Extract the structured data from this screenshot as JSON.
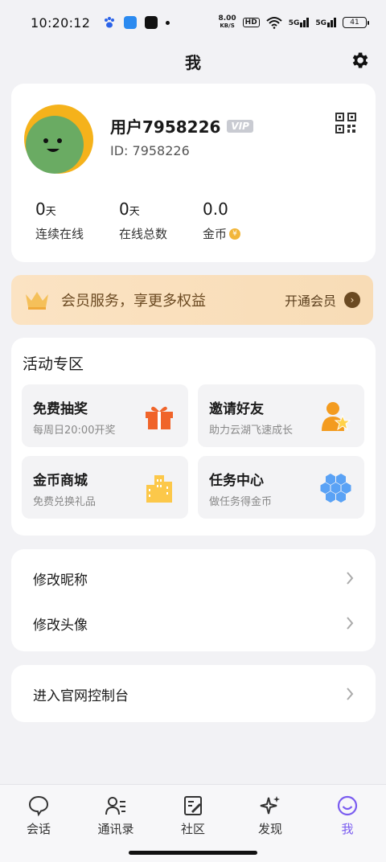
{
  "status_bar": {
    "time": "10:20:12",
    "net_speed": "8.00",
    "net_unit": "KB/S",
    "hd": "HD",
    "signal1": "5G",
    "signal2": "5G",
    "battery": "41"
  },
  "header": {
    "title": "我"
  },
  "profile": {
    "username": "用户7958226",
    "vip_badge": "VIP",
    "user_id": "ID: 7958226",
    "stats": [
      {
        "value": "0",
        "unit": "天",
        "label": "连续在线"
      },
      {
        "value": "0",
        "unit": "天",
        "label": "在线总数"
      },
      {
        "value": "0.0",
        "unit": "",
        "label": "金币"
      }
    ]
  },
  "vip_banner": {
    "text": "会员服务，享更多权益",
    "action": "开通会员"
  },
  "activity": {
    "title": "活动专区",
    "tiles": [
      {
        "title": "免费抽奖",
        "subtitle": "每周日20:00开奖",
        "icon": "gift-icon"
      },
      {
        "title": "邀请好友",
        "subtitle": "助力云湖飞速成长",
        "icon": "invite-user-icon"
      },
      {
        "title": "金币商城",
        "subtitle": "免费兑换礼品",
        "icon": "shop-building-icon"
      },
      {
        "title": "任务中心",
        "subtitle": "做任务得金币",
        "icon": "hexagon-cluster-icon"
      }
    ]
  },
  "menu": {
    "items": [
      "修改昵称",
      "修改头像"
    ],
    "console": "进入官网控制台"
  },
  "tabbar": {
    "tabs": [
      "会话",
      "通讯录",
      "社区",
      "发现",
      "我"
    ],
    "active_index": 4
  },
  "colors": {
    "accent": "#7a5cf0",
    "vip_banner_bg": "#fbe3c3",
    "avatar_green": "#6aab63",
    "avatar_yellow": "#f5b21b"
  }
}
